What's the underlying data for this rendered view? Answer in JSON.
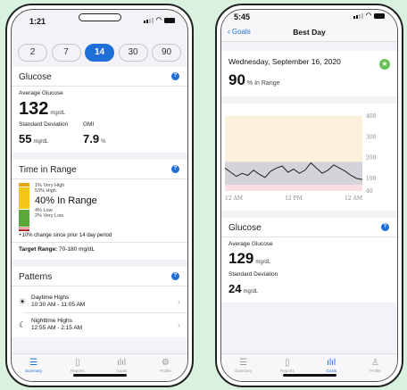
{
  "left": {
    "status_time": "1:21",
    "ranges": [
      "2",
      "7",
      "14",
      "30",
      "90"
    ],
    "selected_range": "14",
    "glucose": {
      "title": "Glucose",
      "avg_label": "Average Glucose",
      "avg_value": "132",
      "avg_unit": "mg/dL",
      "sd_label": "Standard Deviation",
      "sd_value": "55",
      "sd_unit": "mg/dL",
      "gmi_label": "GMI",
      "gmi_value": "7.9",
      "gmi_unit": "%"
    },
    "time_in_range": {
      "title": "Time in Range",
      "very_high": "1% Very High",
      "high": "53% High",
      "in_range": "40% In Range",
      "low": "4% Low",
      "very_low": "2% Very Low",
      "change": "+10% change since prior 14 day period",
      "target_label": "Target Range:",
      "target_value": "70-180 mg/dL",
      "segments": [
        {
          "name": "very-high",
          "pct": 1,
          "color": "#e8a317"
        },
        {
          "name": "high",
          "pct": 53,
          "color": "#f5c518"
        },
        {
          "name": "in-range",
          "pct": 40,
          "color": "#5aa83a"
        },
        {
          "name": "low",
          "pct": 4,
          "color": "#e0484f"
        },
        {
          "name": "very-low",
          "pct": 2,
          "color": "#b0202a"
        }
      ]
    },
    "patterns": {
      "title": "Patterns",
      "items": [
        {
          "name": "Daytime Highs",
          "time": "10:30 AM - 11:05 AM",
          "icon": "sun-icon"
        },
        {
          "name": "Nighttime Highs",
          "time": "12:55 AM - 2:15 AM",
          "icon": "moon-icon"
        }
      ]
    },
    "tabs": [
      "Summary",
      "Reports",
      "Goals",
      "Profile"
    ],
    "active_tab": "Summary"
  },
  "right": {
    "status_time": "5:45",
    "back_label": "Goals",
    "nav_title": "Best Day",
    "date": "Wednesday, September 16, 2020",
    "in_range_value": "90",
    "in_range_label": "% In Range",
    "chart_data": {
      "type": "line",
      "y_ticks": [
        "400",
        "300",
        "200",
        "100",
        "40"
      ],
      "x_ticks": [
        "12 AM",
        "12 PM",
        "12 AM"
      ],
      "ylim": [
        40,
        400
      ],
      "target_band": [
        70,
        180
      ],
      "x": [
        0,
        1,
        2,
        3,
        4,
        5,
        6,
        7,
        8,
        9,
        10,
        11,
        12,
        13,
        14,
        15,
        16,
        17,
        18,
        19,
        20,
        21,
        22,
        23,
        24
      ],
      "values": [
        150,
        130,
        110,
        125,
        115,
        140,
        120,
        105,
        135,
        150,
        160,
        130,
        145,
        125,
        140,
        175,
        150,
        125,
        140,
        165,
        150,
        135,
        115,
        100,
        95
      ]
    },
    "glucose": {
      "title": "Glucose",
      "avg_label": "Average Glucose",
      "avg_value": "129",
      "avg_unit": "mg/dL",
      "sd_label": "Standard Deviation",
      "sd_value": "24",
      "sd_unit": "mg/dL"
    },
    "tabs": [
      "Summary",
      "Reports",
      "Goals",
      "Profile"
    ],
    "active_tab": "Goals"
  },
  "colors": {
    "accent": "#1f6fd8",
    "background": "#d9f2df",
    "award": "#6bbf59",
    "high_band": "#fbf1dd",
    "low_band": "#f9dde0",
    "target_band": "#d4d4d8"
  }
}
